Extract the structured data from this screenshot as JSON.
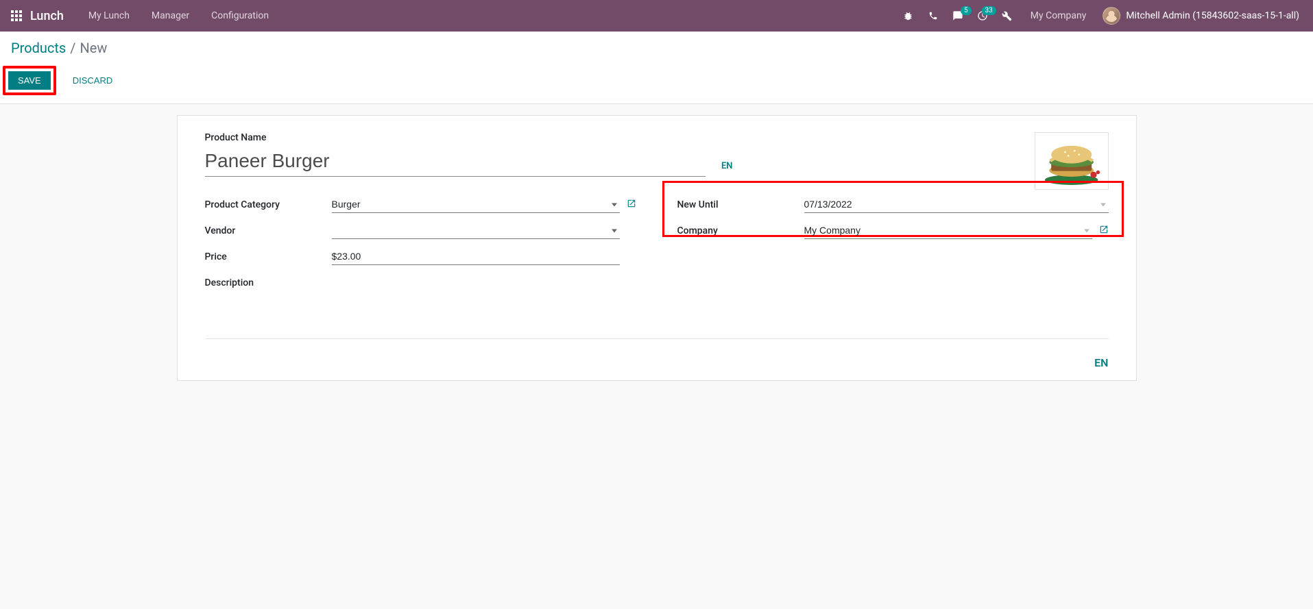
{
  "navbar": {
    "brand": "Lunch",
    "menu": {
      "my_lunch": "My Lunch",
      "manager": "Manager",
      "configuration": "Configuration"
    },
    "messages_badge": "5",
    "activities_badge": "33",
    "company": "My Company",
    "user": "Mitchell Admin (15843602-saas-15-1-all)"
  },
  "breadcrumb": {
    "parent": "Products",
    "current": "New"
  },
  "buttons": {
    "save": "SAVE",
    "discard": "DISCARD"
  },
  "form": {
    "product_name_label": "Product Name",
    "product_name": "Paneer Burger",
    "lang_badge": "EN",
    "category_label": "Product Category",
    "category": "Burger",
    "vendor_label": "Vendor",
    "vendor": "",
    "price_label": "Price",
    "price": "$23.00",
    "description_label": "Description",
    "new_until_label": "New Until",
    "new_until": "07/13/2022",
    "company_label": "Company",
    "company": "My Company"
  }
}
